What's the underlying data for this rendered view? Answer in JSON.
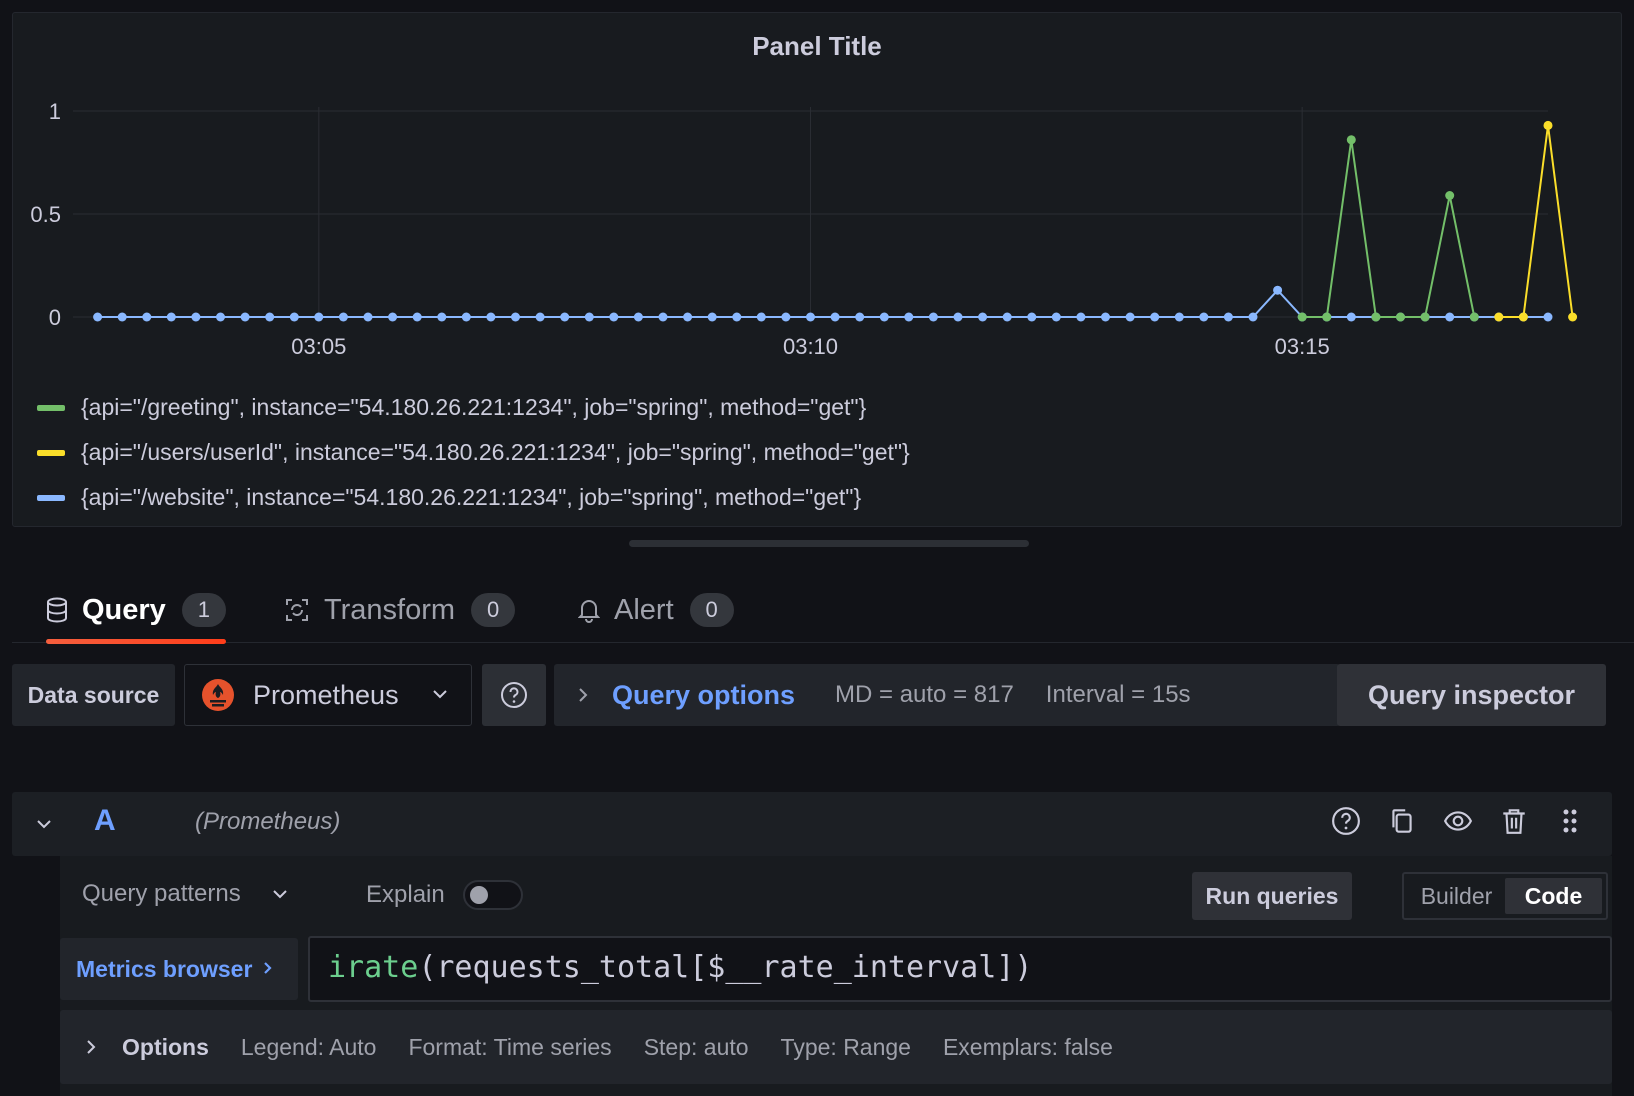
{
  "panel": {
    "title": "Panel Title"
  },
  "chart_data": {
    "type": "line",
    "title": "Panel Title",
    "x_ticks": [
      "03:05",
      "03:10",
      "03:15"
    ],
    "y_ticks": [
      "0",
      "0.5",
      "1"
    ],
    "ylim": [
      0,
      1
    ],
    "xlim": [
      "03:02:30",
      "03:17:30"
    ],
    "x_interval_seconds": 15,
    "x_start": "03:02:45",
    "grid": true,
    "legend_position": "bottom",
    "series": [
      {
        "name": "{api=\"/greeting\", instance=\"54.180.26.221:1234\", job=\"spring\", method=\"get\"}",
        "color": "#73bf69",
        "points": [
          {
            "x": "03:15:00",
            "y": 0
          },
          {
            "x": "03:15:15",
            "y": 0
          },
          {
            "x": "03:15:30",
            "y": 0.86
          },
          {
            "x": "03:15:45",
            "y": 0
          },
          {
            "x": "03:16:00",
            "y": 0
          },
          {
            "x": "03:16:15",
            "y": 0
          },
          {
            "x": "03:16:30",
            "y": 0.59
          },
          {
            "x": "03:16:45",
            "y": 0
          }
        ]
      },
      {
        "name": "{api=\"/users/userId\", instance=\"54.180.26.221:1234\", job=\"spring\", method=\"get\"}",
        "color": "#fade2a",
        "points": [
          {
            "x": "03:17:00",
            "y": 0
          },
          {
            "x": "03:17:15",
            "y": 0
          },
          {
            "x": "03:17:30",
            "y": 0.93
          },
          {
            "x": "03:17:45",
            "y": 0
          }
        ]
      },
      {
        "name": "{api=\"/website\", instance=\"54.180.26.221:1234\", job=\"spring\", method=\"get\"}",
        "color": "#8ab8ff",
        "values": [
          0,
          0,
          0,
          0,
          0,
          0,
          0,
          0,
          0,
          0,
          0,
          0,
          0,
          0,
          0,
          0,
          0,
          0,
          0,
          0,
          0,
          0,
          0,
          0,
          0,
          0,
          0,
          0,
          0,
          0,
          0,
          0,
          0,
          0,
          0,
          0,
          0,
          0,
          0,
          0,
          0,
          0,
          0,
          0,
          0,
          0,
          0,
          0,
          0.13,
          0,
          0,
          0,
          0,
          0,
          0,
          0,
          0,
          0,
          0,
          0
        ]
      }
    ]
  },
  "tabs": [
    {
      "label": "Query",
      "count": "1"
    },
    {
      "label": "Transform",
      "count": "0"
    },
    {
      "label": "Alert",
      "count": "0"
    }
  ],
  "datasource": {
    "label": "Data source",
    "selected": "Prometheus"
  },
  "query_options": {
    "title": "Query options",
    "md": "MD = auto = 817",
    "interval": "Interval = 15s"
  },
  "query_inspector_label": "Query inspector",
  "query_row": {
    "ref_id": "A",
    "datasource": "(Prometheus)"
  },
  "editor": {
    "query_patterns": "Query patterns",
    "explain": "Explain",
    "run_queries": "Run queries",
    "modes": [
      "Builder",
      "Code"
    ],
    "metrics_browser": "Metrics browser",
    "query_fn": "irate",
    "query_rest": "(requests_total[$__rate_interval])",
    "options_label": "Options",
    "options": [
      "Legend: Auto",
      "Format: Time series",
      "Step: auto",
      "Type: Range",
      "Exemplars: false"
    ]
  },
  "colors": {
    "accent": "#6e9fff",
    "tab_underline": "#ff5722"
  }
}
